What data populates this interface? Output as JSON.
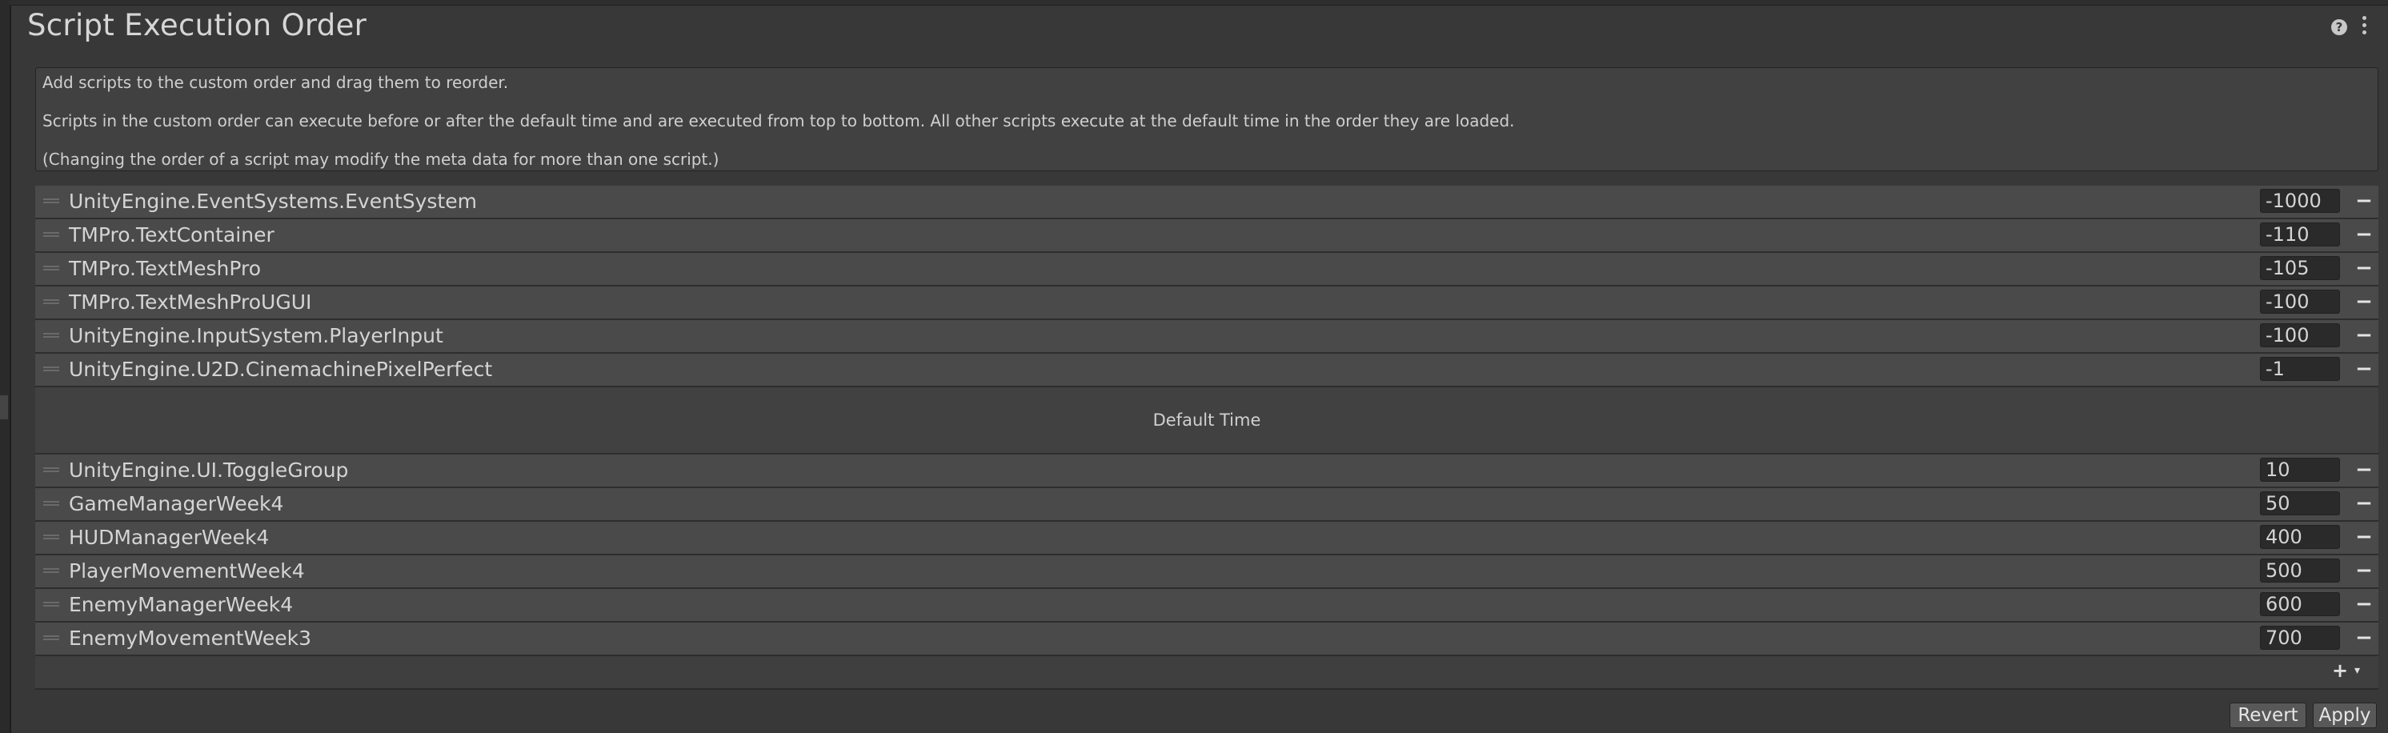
{
  "window": {
    "title": "Script Execution Order",
    "help_icon": "?",
    "menu_icon": "kebab-menu-icon"
  },
  "description": {
    "line1": "Add scripts to the custom order and drag them to reorder.",
    "line2": "Scripts in the custom order can execute before or after the default time and are executed from top to bottom. All other scripts execute at the default time in the order they are loaded.",
    "line3": "(Changing the order of a script may modify the meta data for more than one script.)"
  },
  "scripts_before": [
    {
      "name": "UnityEngine.EventSystems.EventSystem",
      "order": "-1000"
    },
    {
      "name": "TMPro.TextContainer",
      "order": "-110"
    },
    {
      "name": "TMPro.TextMeshPro",
      "order": "-105"
    },
    {
      "name": "TMPro.TextMeshProUGUI",
      "order": "-100"
    },
    {
      "name": "UnityEngine.InputSystem.PlayerInput",
      "order": "-100"
    },
    {
      "name": "UnityEngine.U2D.CinemachinePixelPerfect",
      "order": "-1"
    }
  ],
  "default_time_label": "Default Time",
  "scripts_after": [
    {
      "name": "UnityEngine.UI.ToggleGroup",
      "order": "10"
    },
    {
      "name": "GameManagerWeek4",
      "order": "50"
    },
    {
      "name": "HUDManagerWeek4",
      "order": "400"
    },
    {
      "name": "PlayerMovementWeek4",
      "order": "500"
    },
    {
      "name": "EnemyManagerWeek4",
      "order": "600"
    },
    {
      "name": "EnemyMovementWeek3",
      "order": "700"
    }
  ],
  "remove_glyph": "−",
  "add_glyph": "+",
  "dropdown_glyph": "▾",
  "buttons": {
    "revert": "Revert",
    "apply": "Apply"
  }
}
